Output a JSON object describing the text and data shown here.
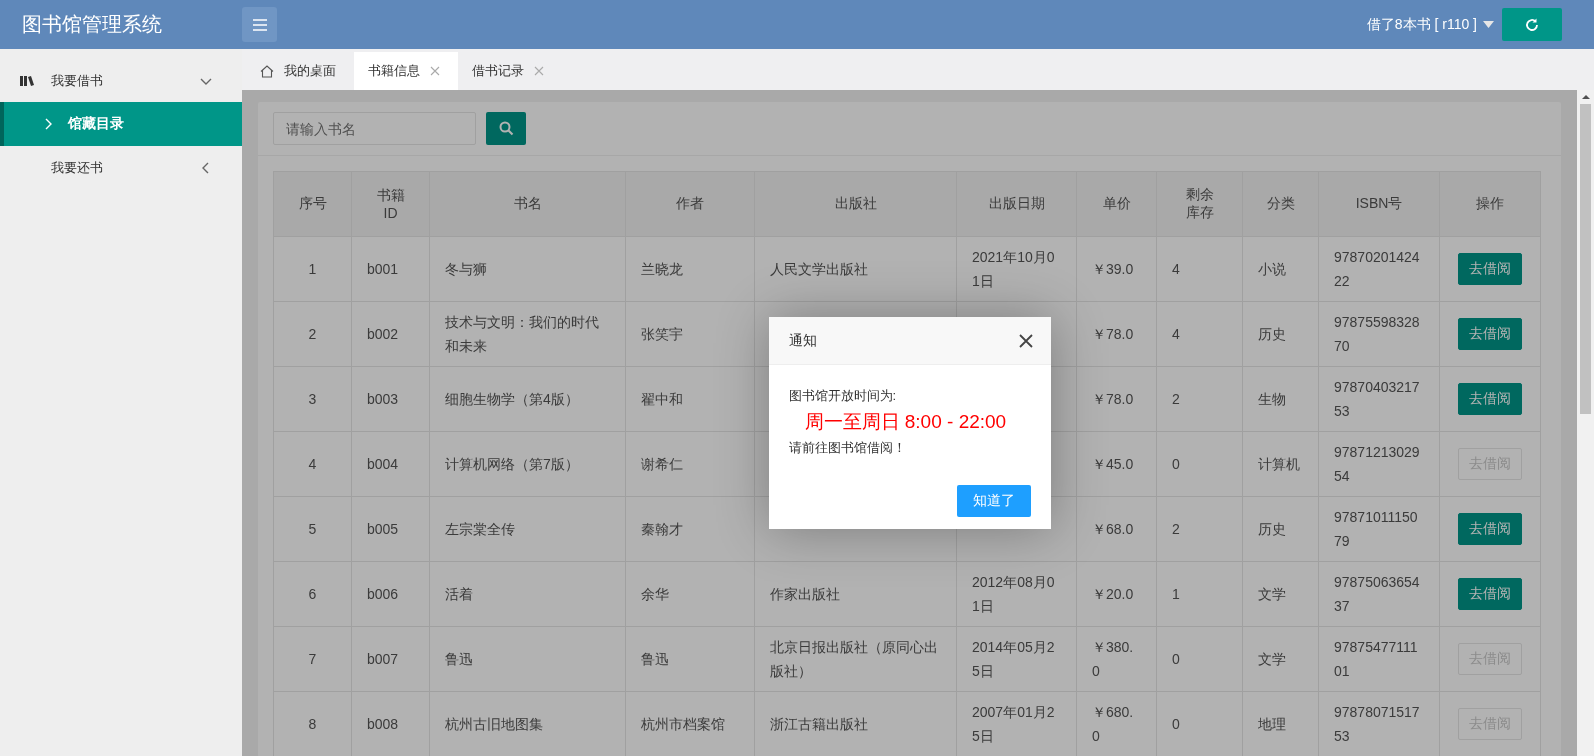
{
  "app": {
    "title": "图书馆管理系统"
  },
  "header": {
    "user_label": "借了8本书 [ r110 ]"
  },
  "sidebar": {
    "items": [
      {
        "label": "我要借书",
        "selected": false,
        "expanded": true,
        "children": [
          {
            "label": "馆藏目录",
            "selected": true
          }
        ]
      },
      {
        "label": "我要还书",
        "selected": false,
        "expanded": false
      }
    ]
  },
  "tabs": [
    {
      "label": "我的桌面",
      "kind": "home",
      "selected": false
    },
    {
      "label": "书籍信息",
      "kind": "page",
      "selected": true
    },
    {
      "label": "借书记录",
      "kind": "page",
      "selected": false
    }
  ],
  "search": {
    "placeholder": "请输入书名"
  },
  "table": {
    "columns": [
      "序号",
      "书籍ID",
      "书名",
      "作者",
      "出版社",
      "出版日期",
      "单价",
      "剩余库存",
      "分类",
      "ISBN号",
      "操作"
    ],
    "rows": [
      {
        "cells": [
          "1",
          "b001",
          "冬与狮",
          "兰晓龙",
          "人民文学出版社",
          "2021年10月01日",
          "￥39.0",
          "4",
          "小说",
          "9787020142422"
        ],
        "action": {
          "label": "去借阅",
          "disabled": false
        }
      },
      {
        "cells": [
          "2",
          "b002",
          "技术与文明：我们的时代和未来",
          "张笑宇",
          null,
          null,
          "￥78.0",
          "4",
          "历史",
          "9787559832870"
        ],
        "action": {
          "label": "去借阅",
          "disabled": false
        }
      },
      {
        "cells": [
          "3",
          "b003",
          "细胞生物学（第4版）",
          "翟中和",
          null,
          null,
          "￥78.0",
          "2",
          "生物",
          "9787040321753"
        ],
        "action": {
          "label": "去借阅",
          "disabled": false
        }
      },
      {
        "cells": [
          "4",
          "b004",
          "计算机网络（第7版）",
          "谢希仁",
          null,
          null,
          "￥45.0",
          "0",
          "计算机",
          "9787121302954"
        ],
        "action": {
          "label": "去借阅",
          "disabled": true
        }
      },
      {
        "cells": [
          "5",
          "b005",
          "左宗棠全传",
          "秦翰才",
          null,
          null,
          "￥68.0",
          "2",
          "历史",
          "9787101115079"
        ],
        "action": {
          "label": "去借阅",
          "disabled": false
        }
      },
      {
        "cells": [
          "6",
          "b006",
          "活着",
          "余华",
          "作家出版社",
          "2012年08月01日",
          "￥20.0",
          "1",
          "文学",
          "9787506365437"
        ],
        "action": {
          "label": "去借阅",
          "disabled": false
        }
      },
      {
        "cells": [
          "7",
          "b007",
          "鲁迅",
          "鲁迅",
          "北京日报出版社（原同心出版社）",
          "2014年05月25日",
          "￥380.0",
          "0",
          "文学",
          "9787547711101"
        ],
        "action": {
          "label": "去借阅",
          "disabled": true
        }
      },
      {
        "cells": [
          "8",
          "b008",
          "杭州古旧地图集",
          "杭州市档案馆",
          "浙江古籍出版社",
          "2007年01月25日",
          "￥680.0",
          "0",
          "地理",
          "9787807151753"
        ],
        "action": {
          "label": "去借阅",
          "disabled": true
        }
      }
    ]
  },
  "dialog": {
    "title": "通知",
    "lines": [
      {
        "kind": "plain",
        "text": "图书馆开放时间为:"
      },
      {
        "kind": "highlight",
        "text": "周一至周日 8:00 - 22:00"
      },
      {
        "kind": "plain",
        "text": "请前往图书馆借阅！"
      }
    ],
    "button": "知道了"
  }
}
